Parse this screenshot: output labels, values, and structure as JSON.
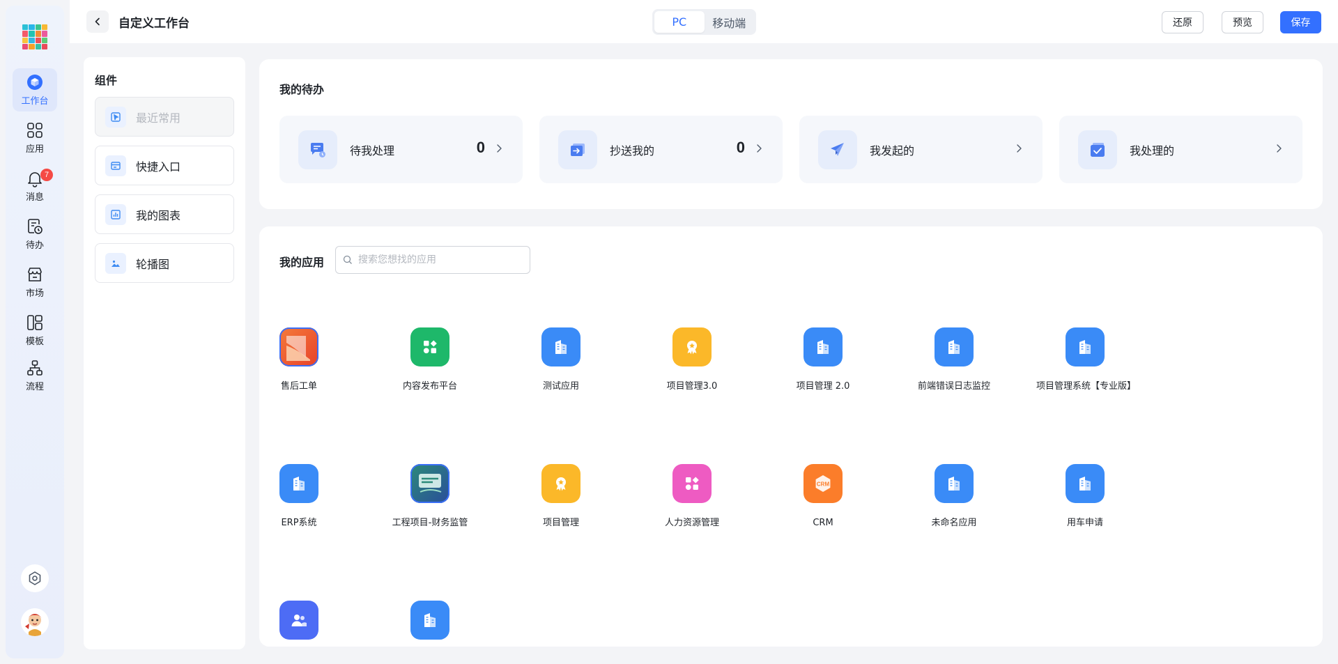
{
  "nav": {
    "items": [
      {
        "label": "工作台",
        "icon": "workbench-icon"
      },
      {
        "label": "应用",
        "icon": "apps-grid-icon"
      },
      {
        "label": "消息",
        "icon": "bell-icon",
        "badge": "7"
      },
      {
        "label": "待办",
        "icon": "todo-clock-icon"
      },
      {
        "label": "市场",
        "icon": "store-icon"
      },
      {
        "label": "模板",
        "icon": "template-icon"
      },
      {
        "label": "流程",
        "icon": "flow-icon"
      }
    ]
  },
  "header": {
    "title": "自定义工作台",
    "tabs": [
      {
        "label": "PC",
        "active": true
      },
      {
        "label": "移动端",
        "active": false
      }
    ],
    "restore_label": "还原",
    "preview_label": "预览",
    "save_label": "保存"
  },
  "components": {
    "title": "组件",
    "items": [
      {
        "label": "最近常用",
        "disabled": true,
        "icon": "recent-icon"
      },
      {
        "label": "快捷入口",
        "disabled": false,
        "icon": "shortcut-icon"
      },
      {
        "label": "我的图表",
        "disabled": false,
        "icon": "chart-icon"
      },
      {
        "label": "轮播图",
        "disabled": false,
        "icon": "carousel-icon"
      }
    ]
  },
  "todo": {
    "title": "我的待办",
    "items": [
      {
        "label": "待我处理",
        "count": "0",
        "icon": "pending-icon"
      },
      {
        "label": "抄送我的",
        "count": "0",
        "icon": "cc-icon"
      },
      {
        "label": "我发起的",
        "count": "",
        "icon": "send-icon"
      },
      {
        "label": "我处理的",
        "count": "",
        "icon": "handled-icon"
      }
    ]
  },
  "apps": {
    "title": "我的应用",
    "search_placeholder": "搜索您想找的应用",
    "items": [
      {
        "name": "售后工单",
        "icon": "image-after-sales",
        "color": "#f06a2a"
      },
      {
        "name": "内容发布平台",
        "icon": "shapes-icon",
        "color": "#1eb86a"
      },
      {
        "name": "测试应用",
        "icon": "building-icon",
        "color": "#3a8bf7"
      },
      {
        "name": "项目管理3.0",
        "icon": "award-icon",
        "color": "#fbb829"
      },
      {
        "name": "项目管理 2.0",
        "icon": "building-icon",
        "color": "#3a8bf7"
      },
      {
        "name": "前端错误日志监控",
        "icon": "building-icon",
        "color": "#3a8bf7"
      },
      {
        "name": "项目管理系统【专业版】",
        "icon": "building-icon",
        "color": "#3a8bf7"
      },
      {
        "name": "ERP系统",
        "icon": "building-icon",
        "color": "#3a8bf7"
      },
      {
        "name": "工程项目-财务监管",
        "icon": "image-finance",
        "color": "#2d6a8f"
      },
      {
        "name": "项目管理",
        "icon": "award-icon",
        "color": "#fbb829"
      },
      {
        "name": "人力资源管理",
        "icon": "shapes-icon",
        "color": "#ee5bc2"
      },
      {
        "name": "CRM",
        "icon": "crm-icon",
        "color": "#fb7d2a",
        "icon_text": "CRM"
      },
      {
        "name": "未命名应用",
        "icon": "building-icon",
        "color": "#3a8bf7"
      },
      {
        "name": "用车申请",
        "icon": "building-icon",
        "color": "#3a8bf7"
      },
      {
        "name": "",
        "icon": "users-icon",
        "color": "#4d6cf5"
      },
      {
        "name": "",
        "icon": "building-icon",
        "color": "#3a8bf7"
      }
    ]
  },
  "colors": {
    "accent": "#3370ff",
    "badge": "#f54a45"
  }
}
